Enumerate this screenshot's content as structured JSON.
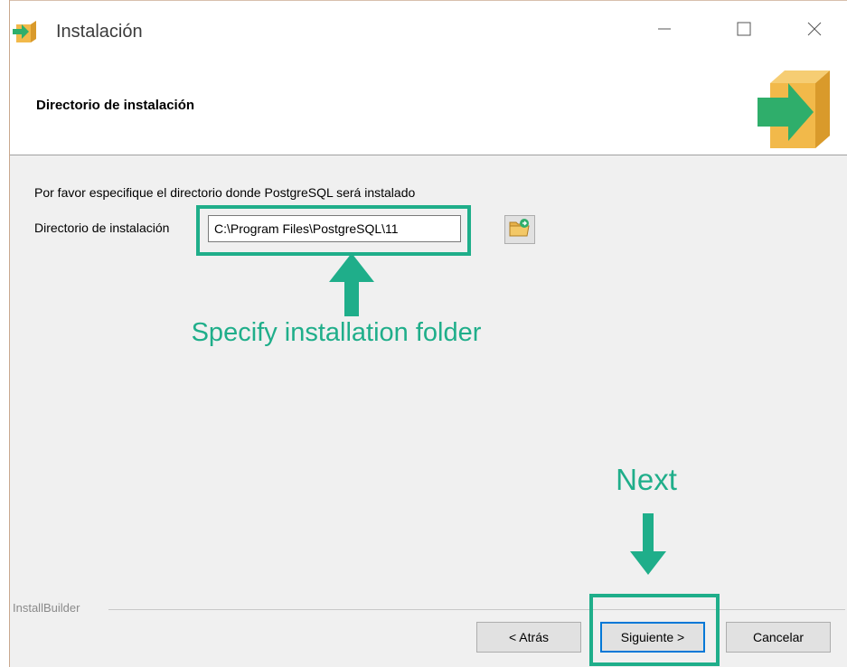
{
  "window": {
    "title": "Instalación",
    "icon": "installer-box-arrow-icon",
    "controls": [
      "minimize-icon",
      "maximize-icon",
      "close-icon"
    ]
  },
  "header": {
    "title": "Directorio de instalación",
    "logo": "installer-box-arrow-icon"
  },
  "content": {
    "instruction": "Por favor especifique el directorio donde PostgreSQL será instalado",
    "directory_label": "Directorio de instalación",
    "directory_value": "C:\\Program Files\\PostgreSQL\\11",
    "browse_icon": "folder-browse-icon"
  },
  "annotations": {
    "specify": "Specify installation folder",
    "next": "Next",
    "color": "#1fae8a"
  },
  "footer": {
    "brand": "InstallBuilder",
    "back_label": "< Atrás",
    "next_label": "Siguiente >",
    "cancel_label": "Cancelar"
  },
  "colors": {
    "panel": "#f0f0f0",
    "logo_box": "#f2b94a",
    "logo_arrow": "#2fae6b"
  }
}
